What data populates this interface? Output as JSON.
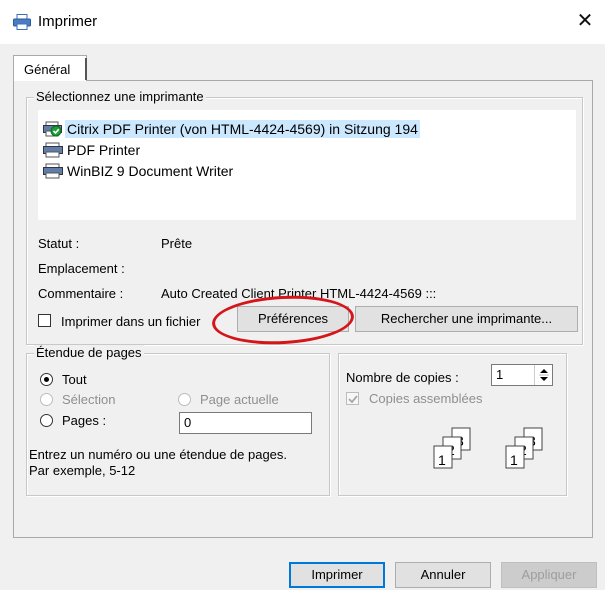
{
  "window": {
    "title": "Imprimer",
    "close_glyph": "✕"
  },
  "tabs": [
    {
      "label": "Général"
    }
  ],
  "printer_group": {
    "legend": "Sélectionnez une imprimante",
    "printers": [
      {
        "name": "Citrix PDF Printer (von HTML-4424-4569) in Sitzung 194",
        "selected": true,
        "icon": "printer-default-icon"
      },
      {
        "name": "PDF Printer",
        "selected": false,
        "icon": "printer-icon"
      },
      {
        "name": "WinBIZ 9 Document Writer",
        "selected": false,
        "icon": "printer-icon"
      }
    ],
    "status_label": "Statut :",
    "status_value": "Prête",
    "location_label": "Emplacement :",
    "location_value": "",
    "comment_label": "Commentaire :",
    "comment_value": "Auto Created Client Printer HTML-4424-4569 :::",
    "print_to_file_label": "Imprimer dans un fichier",
    "preferences_button": "Préférences",
    "find_printer_button": "Rechercher une imprimante..."
  },
  "page_range": {
    "legend": "Étendue de pages",
    "all_label": "Tout",
    "selection_label": "Sélection",
    "current_page_label": "Page actuelle",
    "pages_label": "Pages :",
    "pages_value": "0",
    "hint_line1": "Entrez un numéro ou une étendue de pages.",
    "hint_line2": "Par exemple, 5-12"
  },
  "copies": {
    "count_label": "Nombre de copies :",
    "count_value": "1",
    "collate_label": "Copies assemblées"
  },
  "footer": {
    "print_button": "Imprimer",
    "cancel_button": "Annuler",
    "apply_button": "Appliquer"
  },
  "colors": {
    "selection": "#cce8ff",
    "annotation": "#d4161b",
    "default_button_border": "#0078d7"
  }
}
